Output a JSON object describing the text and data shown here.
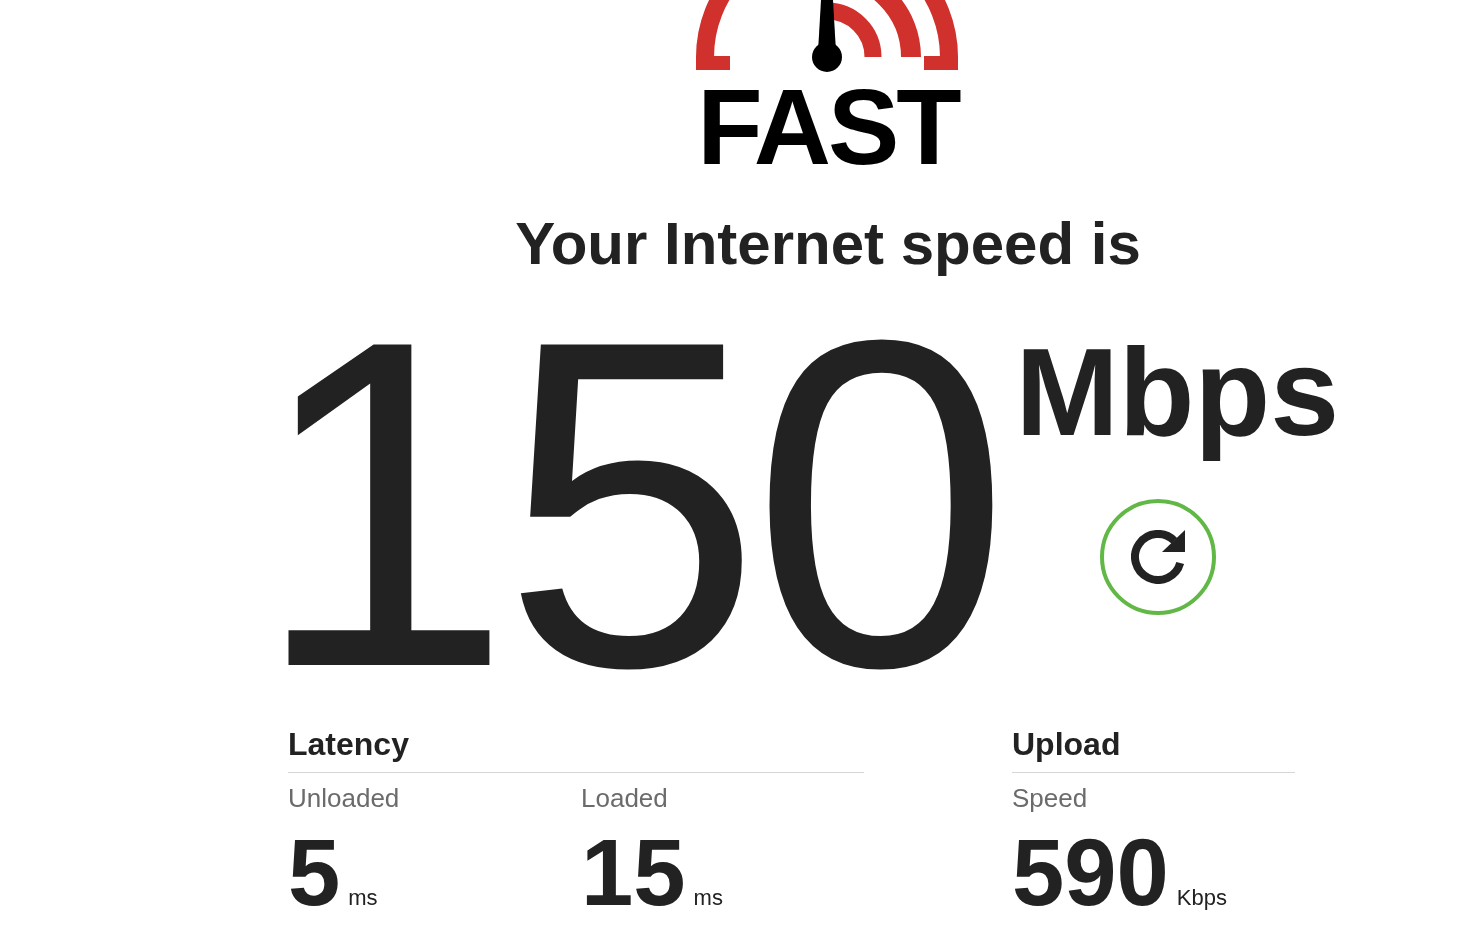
{
  "logo": {
    "text": "FAST"
  },
  "heading": "Your Internet speed is",
  "speed": {
    "value": "150",
    "unit": "Mbps"
  },
  "metrics": [
    {
      "title": "Latency",
      "items": [
        {
          "label": "Unloaded",
          "value": "5",
          "unit": "ms"
        },
        {
          "label": "Loaded",
          "value": "15",
          "unit": "ms"
        }
      ]
    },
    {
      "title": "Upload",
      "items": [
        {
          "label": "Speed",
          "value": "590",
          "unit": "Kbps"
        }
      ]
    }
  ]
}
